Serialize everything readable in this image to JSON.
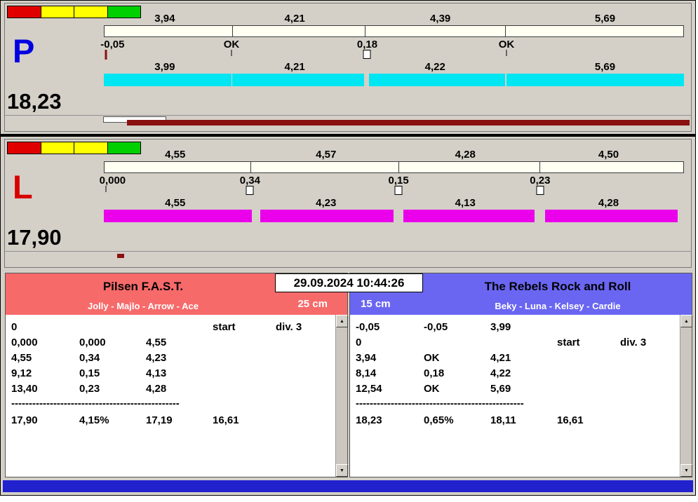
{
  "datetime": "29.09.2024 10:44:26",
  "colors": {
    "window_bg": "#d4d0c8",
    "bottom_bar": "#2121ce",
    "cream_bar": "#fffff2",
    "progress_red": "#8b1010"
  },
  "icons": {
    "up_arrow": "▲",
    "down_arrow": "▼"
  },
  "lanes": [
    {
      "letter": "P",
      "letter_color": "#0000e0",
      "total": "18,23",
      "bar_color": "#00e6f2",
      "lights": [
        "#e10000",
        "#ffff00",
        "#ffff00",
        "#00cf00"
      ],
      "top_times": [
        "3,94",
        "4,21",
        "4,39",
        "5,69"
      ],
      "marks": [
        "-0,05",
        "OK",
        "0,18",
        "OK"
      ],
      "bottom_times": [
        "3,99",
        "4,21",
        "4,22",
        "5,69"
      ]
    },
    {
      "letter": "L",
      "letter_color": "#d90000",
      "total": "17,90",
      "bar_color": "#ea00ea",
      "lights": [
        "#e10000",
        "#ffff00",
        "#ffff00",
        "#00cf00"
      ],
      "top_times": [
        "4,55",
        "4,57",
        "4,28",
        "4,50"
      ],
      "marks": [
        "0,000",
        "0,34",
        "0,15",
        "0,23"
      ],
      "bottom_times": [
        "4,55",
        "4,23",
        "4,13",
        "4,28"
      ]
    }
  ],
  "teams": [
    {
      "name": "Pilsen F.A.S.T.",
      "dogs": "Jolly - Majlo - Arrow - Ace",
      "height": "25 cm",
      "header_color": "#f76a6a",
      "rows": [
        [
          "0",
          "",
          "",
          "start",
          "div. 3"
        ],
        [
          "0,000",
          "0,000",
          "4,55",
          "",
          ""
        ],
        [
          "4,55",
          "0,34",
          "4,23",
          "",
          ""
        ],
        [
          "9,12",
          "0,15",
          "4,13",
          "",
          ""
        ],
        [
          "13,40",
          "0,23",
          "4,28",
          "",
          ""
        ]
      ],
      "separator": "------------------------------------------------",
      "totals": [
        "17,90",
        "4,15%",
        "17,19",
        "16,61"
      ]
    },
    {
      "name": "The Rebels Rock and Roll",
      "dogs": "Beky - Luna - Kelsey - Cardie",
      "height": "15 cm",
      "header_color": "#6a66f2",
      "rows": [
        [
          "-0,05",
          "-0,05",
          "3,99",
          "",
          ""
        ],
        [
          "0",
          "",
          "",
          "start",
          "div. 3"
        ],
        [
          "3,94",
          "OK",
          "4,21",
          "",
          ""
        ],
        [
          "8,14",
          "0,18",
          "4,22",
          "",
          ""
        ],
        [
          "12,54",
          "OK",
          "5,69",
          "",
          ""
        ]
      ],
      "separator": "------------------------------------------------",
      "totals": [
        "18,23",
        "0,65%",
        "18,11",
        "16,61"
      ]
    }
  ]
}
